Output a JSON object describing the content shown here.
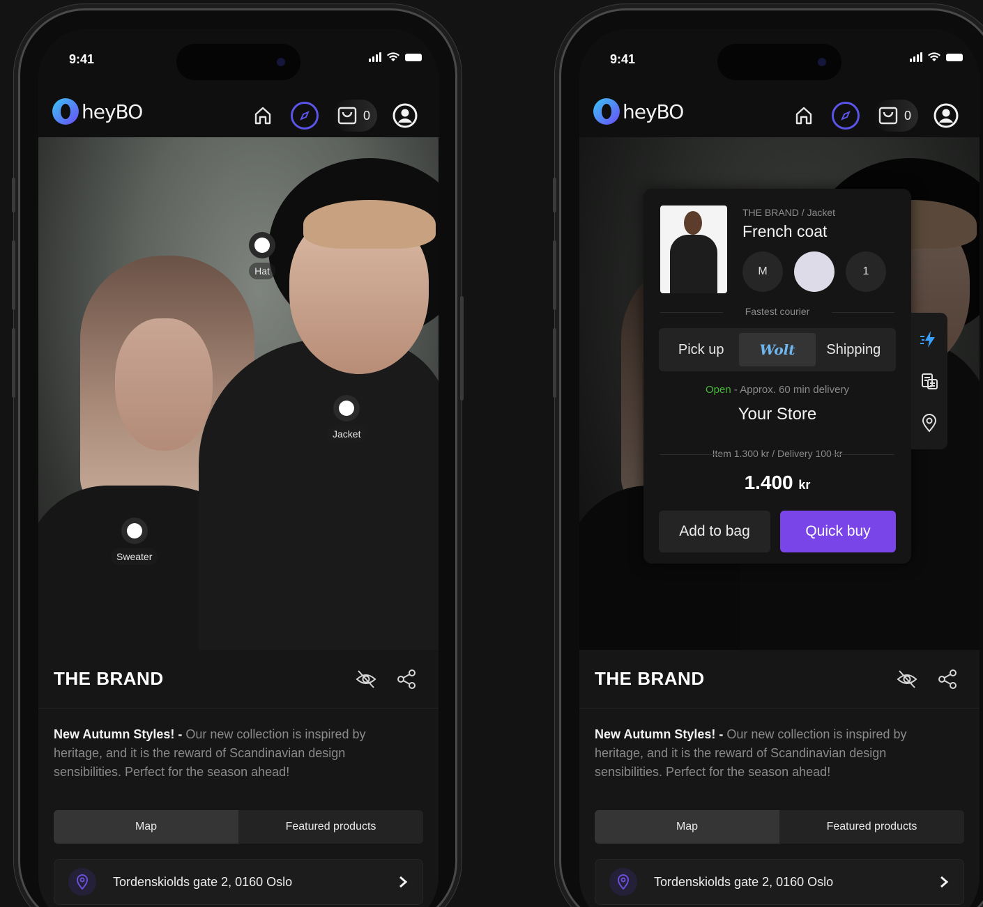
{
  "status": {
    "time": "9:41"
  },
  "app": {
    "logo_text": "heyBO",
    "cart_count": "0"
  },
  "hotspots": {
    "hat": "Hat",
    "jacket": "Jacket",
    "sweater": "Sweater"
  },
  "brand": {
    "title": "THE BRAND"
  },
  "description": {
    "lead": "New Autumn Styles! -",
    "body": " Our new collection is inspired by heritage, and it is the reward of Scandinavian design sensibilities. Perfect for the season ahead!"
  },
  "tabs": {
    "map": "Map",
    "featured": "Featured products"
  },
  "address": {
    "text": "Tordenskiolds gate 2, 0160 Oslo"
  },
  "popup": {
    "breadcrumb": "THE BRAND / Jacket",
    "product_name": "French coat",
    "size": "M",
    "color_swatch": "#dedbe8",
    "quantity": "1",
    "fastest_label": "Fastest courier",
    "delivery": {
      "pickup": "Pick up",
      "wolt": "Wolt",
      "shipping": "Shipping"
    },
    "open_status": "Open",
    "open_detail": " - Approx. 60 min delivery",
    "store_name": "Your Store",
    "breakdown": "Item 1.300 kr / Delivery 100 kr",
    "price_value": "1.400",
    "price_currency": "kr",
    "add_to_bag": "Add to bag",
    "quick_buy": "Quick buy"
  },
  "colors": {
    "accent": "#7a45e8",
    "nav_active": "#5a55e8",
    "open_green": "#47b53a",
    "wolt_blue": "#6fb5ee"
  }
}
